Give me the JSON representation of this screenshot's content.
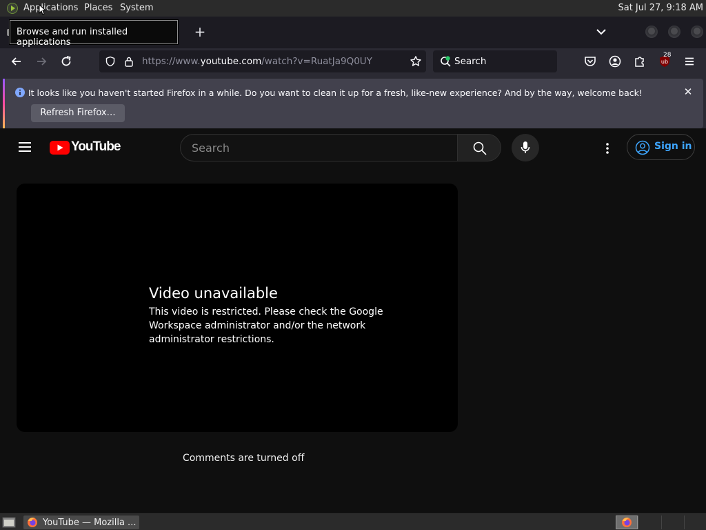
{
  "top_panel": {
    "menus": [
      "Applications",
      "Places",
      "System"
    ],
    "clock": "Sat Jul 27,  9:18 AM"
  },
  "tooltip": "Browse and run installed applications",
  "toolbar": {
    "url_prefix": "https://www.",
    "url_host": "youtube.com",
    "url_path": "/watch?v=RuatJa9Q0UY",
    "search_placeholder": "Search",
    "extension_badge": "28"
  },
  "notification": {
    "message": "It looks like you haven't started Firefox in a while. Do you want to clean it up for a fresh, like-new experience? And by the way, welcome back!",
    "button_label": "Refresh Firefox…"
  },
  "youtube": {
    "logo_text": "YouTube",
    "search_placeholder": "Search",
    "sign_in_label": "Sign in",
    "error_title": "Video unavailable",
    "error_message": "This video is restricted. Please check the Google Workspace administrator and/or the network administrator restrictions.",
    "comments_status": "Comments are turned off"
  },
  "taskbar": {
    "window_label": "YouTube — Mozilla ..."
  },
  "colors": {
    "accent_blue": "#3ea6ff",
    "youtube_red": "#ff0000",
    "page_bg": "#0f0f0f"
  }
}
